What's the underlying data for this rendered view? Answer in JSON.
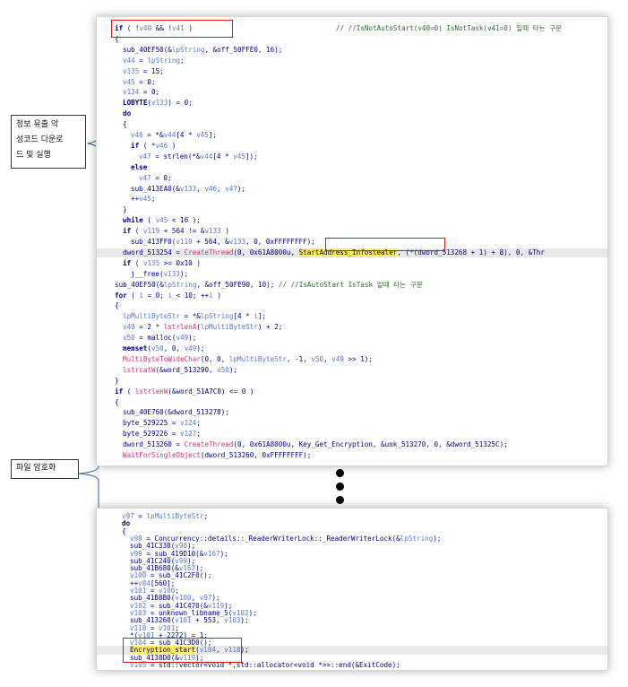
{
  "annotations": {
    "label1_lines": [
      "정보 유출 악",
      "성코드 다운로",
      "드 및 실행"
    ],
    "label2": "파일 암호화"
  },
  "colors": {
    "keyword": "#000080",
    "variable": "#5577cc",
    "comment": "#2b6b2b",
    "api": "#d0307b",
    "highlight_yellow": "#ffee55",
    "red_box": "#e01818"
  },
  "code_top": [
    {
      "indent": 0,
      "tokens": [
        [
          "kw",
          "if"
        ],
        [
          "p",
          " ( !"
        ],
        [
          "v",
          "v40"
        ],
        [
          "p",
          " && !"
        ],
        [
          "v",
          "v41"
        ],
        [
          "p",
          " )                                   "
        ],
        [
          "c",
          "// //IsNotAutoStart(v40=0) IsNotTask(v41=0) 일때 타는 구문"
        ]
      ]
    },
    {
      "indent": 0,
      "tokens": [
        [
          "p",
          "{"
        ]
      ]
    },
    {
      "indent": 1,
      "tokens": [
        [
          "f",
          "sub_40EF50"
        ],
        [
          "p",
          "(&"
        ],
        [
          "v",
          "lpString"
        ],
        [
          "p",
          ", &off_50FFE0, 16);"
        ]
      ]
    },
    {
      "indent": 1,
      "tokens": [
        [
          "v",
          "v44"
        ],
        [
          "p",
          " = "
        ],
        [
          "v",
          "lpString"
        ],
        [
          "p",
          ";"
        ]
      ]
    },
    {
      "indent": 1,
      "tokens": [
        [
          "v",
          "v135"
        ],
        [
          "p",
          " = 15;"
        ]
      ]
    },
    {
      "indent": 1,
      "tokens": [
        [
          "v",
          "v45"
        ],
        [
          "p",
          " = 0;"
        ]
      ]
    },
    {
      "indent": 1,
      "tokens": [
        [
          "v",
          "v134"
        ],
        [
          "p",
          " = 0;"
        ]
      ]
    },
    {
      "indent": 1,
      "tokens": [
        [
          "kw",
          "LOBYTE"
        ],
        [
          "p",
          "("
        ],
        [
          "v",
          "v133"
        ],
        [
          "p",
          ") = 0;"
        ]
      ]
    },
    {
      "indent": 1,
      "tokens": [
        [
          "kw",
          "do"
        ]
      ]
    },
    {
      "indent": 1,
      "tokens": [
        [
          "p",
          "{"
        ]
      ]
    },
    {
      "indent": 2,
      "tokens": [
        [
          "v",
          "v46"
        ],
        [
          "p",
          " = *&"
        ],
        [
          "v",
          "v44"
        ],
        [
          "p",
          "[4 * "
        ],
        [
          "v",
          "v45"
        ],
        [
          "p",
          "];"
        ]
      ]
    },
    {
      "indent": 2,
      "tokens": [
        [
          "kw",
          "if"
        ],
        [
          "p",
          " ( *"
        ],
        [
          "v",
          "v46"
        ],
        [
          "p",
          " )"
        ]
      ]
    },
    {
      "indent": 3,
      "tokens": [
        [
          "v",
          "v47"
        ],
        [
          "p",
          " = strlen(*&"
        ],
        [
          "v",
          "v44"
        ],
        [
          "p",
          "[4 * "
        ],
        [
          "v",
          "v45"
        ],
        [
          "p",
          "]);"
        ]
      ]
    },
    {
      "indent": 2,
      "tokens": [
        [
          "kw",
          "else"
        ]
      ]
    },
    {
      "indent": 3,
      "tokens": [
        [
          "v",
          "v47"
        ],
        [
          "p",
          " = 0;"
        ]
      ]
    },
    {
      "indent": 2,
      "tokens": [
        [
          "f",
          "sub_413EA0"
        ],
        [
          "p",
          "(&"
        ],
        [
          "v",
          "v133"
        ],
        [
          "p",
          ", "
        ],
        [
          "v",
          "v46"
        ],
        [
          "p",
          ", "
        ],
        [
          "v",
          "v47"
        ],
        [
          "p",
          ");"
        ]
      ]
    },
    {
      "indent": 2,
      "tokens": [
        [
          "p",
          "++"
        ],
        [
          "v",
          "v45"
        ],
        [
          "p",
          ";"
        ]
      ]
    },
    {
      "indent": 1,
      "tokens": [
        [
          "p",
          "}"
        ]
      ]
    },
    {
      "indent": 1,
      "tokens": [
        [
          "kw",
          "while"
        ],
        [
          "p",
          " ( "
        ],
        [
          "v",
          "v45"
        ],
        [
          "p",
          " < 16 );"
        ]
      ]
    },
    {
      "indent": 1,
      "tokens": [
        [
          "kw",
          "if"
        ],
        [
          "p",
          " ( "
        ],
        [
          "v",
          "v119"
        ],
        [
          "p",
          " + 564 != &"
        ],
        [
          "v",
          "v133"
        ],
        [
          "p",
          " )"
        ]
      ]
    },
    {
      "indent": 2,
      "tokens": [
        [
          "f",
          "sub_413FF0"
        ],
        [
          "p",
          "("
        ],
        [
          "v",
          "v119"
        ],
        [
          "p",
          " + 564, &"
        ],
        [
          "v",
          "v133"
        ],
        [
          "p",
          ", 0, 0xFFFFFFFF);"
        ]
      ]
    },
    {
      "indent": 1,
      "hl": true,
      "tokens": [
        [
          "p",
          "dword_513254 = "
        ],
        [
          "a",
          "CreateThread"
        ],
        [
          "p",
          "(0, 0x61A8000u, "
        ],
        [
          "y",
          "StartAddress_Infostealer"
        ],
        [
          "p",
          ", (*(dword_513268 + 1) + 8), 0, &Thr"
        ]
      ]
    },
    {
      "indent": 1,
      "tokens": [
        [
          "kw",
          "if"
        ],
        [
          "p",
          " ( "
        ],
        [
          "v",
          "v135"
        ],
        [
          "p",
          " >= 0x10 )"
        ]
      ]
    },
    {
      "indent": 2,
      "tokens": [
        [
          "f",
          "j__free"
        ],
        [
          "p",
          "("
        ],
        [
          "v",
          "v133"
        ],
        [
          "p",
          ");"
        ]
      ]
    },
    {
      "indent": 0,
      "tokens": [
        [
          "f",
          "sub_40EF50"
        ],
        [
          "p",
          "(&"
        ],
        [
          "v",
          "lpString"
        ],
        [
          "p",
          ", &off_50FE90, 10); "
        ],
        [
          "c",
          "// //IsAutoStart IsTask 일때 타는 구문"
        ]
      ]
    },
    {
      "indent": 0,
      "tokens": [
        [
          "kw",
          "for"
        ],
        [
          "p",
          " ( "
        ],
        [
          "v",
          "i"
        ],
        [
          "p",
          " = 0; "
        ],
        [
          "v",
          "i"
        ],
        [
          "p",
          " < 10; ++"
        ],
        [
          "v",
          "i"
        ],
        [
          "p",
          " )"
        ]
      ]
    },
    {
      "indent": 0,
      "tokens": [
        [
          "p",
          "{"
        ]
      ]
    },
    {
      "indent": 1,
      "tokens": [
        [
          "v",
          "lpMultiByteStr"
        ],
        [
          "p",
          " = *&"
        ],
        [
          "v",
          "lpString"
        ],
        [
          "p",
          "[4 * "
        ],
        [
          "v",
          "i"
        ],
        [
          "p",
          "];"
        ]
      ]
    },
    {
      "indent": 1,
      "tokens": [
        [
          "v",
          "v49"
        ],
        [
          "p",
          " = 2 * "
        ],
        [
          "a",
          "lstrlenA"
        ],
        [
          "p",
          "("
        ],
        [
          "v",
          "lpMultiByteStr"
        ],
        [
          "p",
          ") + 2;"
        ]
      ]
    },
    {
      "indent": 1,
      "tokens": [
        [
          "v",
          "v50"
        ],
        [
          "p",
          " = malloc("
        ],
        [
          "v",
          "v49"
        ],
        [
          "p",
          ");"
        ]
      ]
    },
    {
      "indent": 1,
      "tokens": [
        [
          "kw",
          "memset"
        ],
        [
          "p",
          "("
        ],
        [
          "v",
          "v50"
        ],
        [
          "p",
          ", 0, "
        ],
        [
          "v",
          "v49"
        ],
        [
          "p",
          ");"
        ]
      ]
    },
    {
      "indent": 1,
      "tokens": [
        [
          "a",
          "MultiByteToWideChar"
        ],
        [
          "p",
          "(0, 0, "
        ],
        [
          "v",
          "lpMultiByteStr"
        ],
        [
          "p",
          ", -1, "
        ],
        [
          "v",
          "v50"
        ],
        [
          "p",
          ", "
        ],
        [
          "v",
          "v49"
        ],
        [
          "p",
          " >> 1);"
        ]
      ]
    },
    {
      "indent": 1,
      "tokens": [
        [
          "a",
          "lstrcatW"
        ],
        [
          "p",
          "(&word_513290, "
        ],
        [
          "v",
          "v50"
        ],
        [
          "p",
          ");"
        ]
      ]
    },
    {
      "indent": 0,
      "tokens": [
        [
          "p",
          "}"
        ]
      ]
    },
    {
      "indent": 0,
      "tokens": [
        [
          "kw",
          "if"
        ],
        [
          "p",
          " ( "
        ],
        [
          "a",
          "lstrlenW"
        ],
        [
          "p",
          "(&word_51A7C0) <= 0 )"
        ]
      ]
    },
    {
      "indent": 0,
      "tokens": [
        [
          "p",
          "{"
        ]
      ]
    },
    {
      "indent": 1,
      "tokens": [
        [
          "f",
          "sub_40E760"
        ],
        [
          "p",
          "(&dword_513278);"
        ]
      ]
    },
    {
      "indent": 1,
      "tokens": [
        [
          "p",
          "byte_529225 = "
        ],
        [
          "v",
          "v124"
        ],
        [
          "p",
          ";"
        ]
      ]
    },
    {
      "indent": 1,
      "tokens": [
        [
          "p",
          "byte_529226 = "
        ],
        [
          "v",
          "v127"
        ],
        [
          "p",
          ";"
        ]
      ]
    },
    {
      "indent": 1,
      "tokens": [
        [
          "p",
          "dword_513260 = "
        ],
        [
          "a",
          "CreateThread"
        ],
        [
          "p",
          "(0, 0x61A8000u, Key_Get_Encryption, &unk_513270, 0, &dword_51325C);"
        ]
      ]
    },
    {
      "indent": 1,
      "tokens": [
        [
          "a",
          "WaitForSingleObject"
        ],
        [
          "p",
          "(dword_513260, 0xFFFFFFFF);"
        ]
      ]
    }
  ],
  "code_bottom": [
    {
      "indent": 0,
      "tokens": [
        [
          "v",
          "v97"
        ],
        [
          "p",
          " = "
        ],
        [
          "v",
          "lpMultiByteStr"
        ],
        [
          "p",
          ";"
        ]
      ]
    },
    {
      "indent": 0,
      "tokens": [
        [
          "kw",
          "do"
        ]
      ]
    },
    {
      "indent": 0,
      "tokens": [
        [
          "p",
          "{"
        ]
      ]
    },
    {
      "indent": 1,
      "tokens": [
        [
          "v",
          "v98"
        ],
        [
          "p",
          " = Concurrency::details::_ReaderWriterLock::_ReaderWriterLock(&"
        ],
        [
          "v",
          "lpString"
        ],
        [
          "p",
          ");"
        ]
      ]
    },
    {
      "indent": 1,
      "tokens": [
        [
          "f",
          "sub_41C330"
        ],
        [
          "p",
          "("
        ],
        [
          "v",
          "v98"
        ],
        [
          "p",
          ");"
        ]
      ]
    },
    {
      "indent": 1,
      "tokens": [
        [
          "v",
          "v99"
        ],
        [
          "p",
          " = "
        ],
        [
          "f",
          "sub_419D10"
        ],
        [
          "p",
          "(&"
        ],
        [
          "v",
          "v167"
        ],
        [
          "p",
          ");"
        ]
      ]
    },
    {
      "indent": 1,
      "tokens": [
        [
          "f",
          "sub_41C240"
        ],
        [
          "p",
          "("
        ],
        [
          "v",
          "v99"
        ],
        [
          "p",
          ");"
        ]
      ]
    },
    {
      "indent": 1,
      "tokens": [
        [
          "f",
          "sub_41B680"
        ],
        [
          "p",
          "(&"
        ],
        [
          "v",
          "v167"
        ],
        [
          "p",
          ");"
        ]
      ]
    },
    {
      "indent": 1,
      "tokens": [
        [
          "v",
          "v100"
        ],
        [
          "p",
          " = "
        ],
        [
          "f",
          "sub_41C2F0"
        ],
        [
          "p",
          "();"
        ]
      ]
    },
    {
      "indent": 1,
      "tokens": [
        [
          "p",
          "++"
        ],
        [
          "v",
          "v84"
        ],
        [
          "p",
          "[560];"
        ]
      ]
    },
    {
      "indent": 1,
      "tokens": [
        [
          "v",
          "v101"
        ],
        [
          "p",
          " = "
        ],
        [
          "v",
          "v100"
        ],
        [
          "p",
          ";"
        ]
      ]
    },
    {
      "indent": 1,
      "tokens": [
        [
          "f",
          "sub_41B8B0"
        ],
        [
          "p",
          "("
        ],
        [
          "v",
          "v100"
        ],
        [
          "p",
          ", "
        ],
        [
          "v",
          "v97"
        ],
        [
          "p",
          ");"
        ]
      ]
    },
    {
      "indent": 1,
      "tokens": [
        [
          "v",
          "v102"
        ],
        [
          "p",
          " = "
        ],
        [
          "f",
          "sub_41C470"
        ],
        [
          "p",
          "(&"
        ],
        [
          "v",
          "v119"
        ],
        [
          "p",
          ");"
        ]
      ]
    },
    {
      "indent": 1,
      "tokens": [
        [
          "v",
          "v103"
        ],
        [
          "p",
          " = unknown_libname_5("
        ],
        [
          "v",
          "v102"
        ],
        [
          "p",
          ");"
        ]
      ]
    },
    {
      "indent": 1,
      "tokens": [
        [
          "f",
          "sub_413260"
        ],
        [
          "p",
          "("
        ],
        [
          "v",
          "v101"
        ],
        [
          "p",
          " + 553, "
        ],
        [
          "v",
          "v103"
        ],
        [
          "p",
          ");"
        ]
      ]
    },
    {
      "indent": 1,
      "tokens": [
        [
          "v",
          "v118"
        ],
        [
          "p",
          " = "
        ],
        [
          "v",
          "v101"
        ],
        [
          "p",
          ";"
        ]
      ]
    },
    {
      "indent": 1,
      "tokens": [
        [
          "p",
          "*("
        ],
        [
          "v",
          "v101"
        ],
        [
          "p",
          " + 2272) = 1;"
        ]
      ]
    },
    {
      "indent": 1,
      "tokens": [
        [
          "v",
          "v104"
        ],
        [
          "p",
          " = "
        ],
        [
          "f",
          "sub_41C3D0"
        ],
        [
          "p",
          "();"
        ]
      ]
    },
    {
      "indent": 1,
      "hl": true,
      "tokens": [
        [
          "y",
          "Encryption_start"
        ],
        [
          "p",
          "("
        ],
        [
          "v",
          "v104"
        ],
        [
          "p",
          ", "
        ],
        [
          "v",
          "v118"
        ],
        [
          "p",
          ");"
        ]
      ]
    },
    {
      "indent": 1,
      "tokens": [
        [
          "f",
          "sub_4138D0"
        ],
        [
          "p",
          "(&"
        ],
        [
          "v",
          "v119"
        ],
        [
          "p",
          ");"
        ]
      ]
    },
    {
      "indent": 1,
      "tokens": [
        [
          "v",
          "v105"
        ],
        [
          "p",
          " = std::vector<void *,std::allocator<void *>>::end(&ExitCode);"
        ]
      ]
    }
  ]
}
